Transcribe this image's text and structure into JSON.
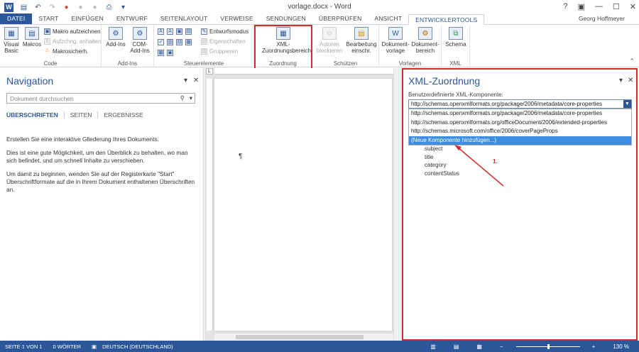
{
  "title": "vorlage.docx - Word",
  "window_controls": [
    "?",
    "▣",
    "—",
    "☐",
    "✕"
  ],
  "qat": [
    "save",
    "undo",
    "redo",
    "record",
    "circle",
    "circle",
    "print",
    "customize"
  ],
  "tabs": [
    "DATEI",
    "START",
    "EINFÜGEN",
    "ENTWURF",
    "SEITENLAYOUT",
    "VERWEISE",
    "SENDUNGEN",
    "ÜBERPRÜFEN",
    "ANSICHT",
    "ENTWICKLERTOOLS"
  ],
  "user": "Georg Hoffmeyer",
  "ribbon": {
    "code": {
      "label": "Code",
      "visual_basic": "Visual Basic",
      "macros": "Makros",
      "record_macro": "Makro aufzeichnen",
      "pause": "Aufzchng. anhalten",
      "macro_security": "Makrosicherh."
    },
    "addins": {
      "label": "Add-Ins",
      "addins": "Add-Ins",
      "com_addins": "COM-Add-Ins"
    },
    "controls": {
      "label": "Steuerelemente",
      "design_mode": "Entwurfsmodus",
      "properties": "Eigenschaften",
      "group": "Gruppieren"
    },
    "mapping": {
      "label": "Zuordnung",
      "xml_pane": "XML-Zuordnungsbereich"
    },
    "protect": {
      "label": "Schützen",
      "block_authors": "Autoren blockieren",
      "restrict_editing": "Bearbeitung einschr."
    },
    "templates": {
      "label": "Vorlagen",
      "doc_template": "Dokument-vorlage",
      "doc_panel": "Dokument-bereich"
    },
    "xml": {
      "label": "XML",
      "schema": "Schema"
    }
  },
  "nav": {
    "title": "Navigation",
    "search_placeholder": "Dokument durchsuchen",
    "tabs": [
      "ÜBERSCHRIFTEN",
      "SEITEN",
      "ERGEBNISSE"
    ],
    "p1": "Erstellen Sie eine interaktive Gliederung Ihres Dokuments.",
    "p2": "Dies ist eine gute Möglichkeit, um den Überblick zu behalten, wo man sich befindet, und um schnell Inhalte zu verschieben.",
    "p3": "Um damit zu beginnen, wenden Sie auf der Registerkarte \"Start\" Überschriftformate auf die in Ihrem Dokument enthaltenen Überschriften an."
  },
  "document": {
    "pilcrow": "¶"
  },
  "xml_pane": {
    "title": "XML-Zuordnung",
    "label": "Benutzerdefinierte XML-Komponente:",
    "selected": "http://schemas.openxmlformats.org/package/2006/metadata/core-properties",
    "options": [
      "http://schemas.openxmlformats.org/package/2006/metadata/core-properties",
      "http://schemas.openxmlformats.org/officeDocument/2006/extended-properties",
      "http://schemas.microsoft.com/office/2006/coverPageProps",
      "(Neue Komponente hinzufügen...)"
    ],
    "tree": [
      "subject",
      "title",
      "category",
      "contentStatus"
    ],
    "annotation": "1."
  },
  "status": {
    "page": "SEITE 1 VON 1",
    "words": "0 WÖRTER",
    "language": "DEUTSCH (DEUTSCHLAND)",
    "zoom": "130 %"
  },
  "colors": {
    "accent": "#2b579a",
    "highlight": "#d52b2b",
    "selection": "#3d8ee0"
  }
}
